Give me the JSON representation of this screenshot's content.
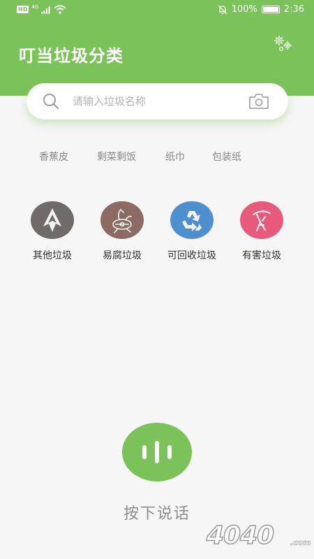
{
  "status_bar": {
    "hd": "HD",
    "network": "4G",
    "battery_text": "100%",
    "battery_level": 1.0,
    "time": "2:36"
  },
  "header": {
    "title": "叮当垃圾分类",
    "settings_icon": "gears-icon",
    "background_color": "#7cc25a"
  },
  "search": {
    "placeholder": "请输入垃圾名称",
    "value": "",
    "search_icon": "search-icon",
    "camera_icon": "camera-icon"
  },
  "hot_tags": [
    "香蕉皮",
    "剩菜剩饭",
    "纸巾",
    "包装纸"
  ],
  "categories": [
    {
      "label": "其他垃圾",
      "icon": "other-waste-icon",
      "color": "#6e6b69"
    },
    {
      "label": "易腐垃圾",
      "icon": "food-waste-icon",
      "color": "#8c6b64"
    },
    {
      "label": "可回收垃圾",
      "icon": "recycle-icon",
      "color": "#4e8fce"
    },
    {
      "label": "有害垃圾",
      "icon": "hazardous-waste-icon",
      "color": "#e85a7b"
    }
  ],
  "voice": {
    "label": "按下说话",
    "icon": "voice-wave-icon"
  },
  "watermark": {
    "text": "4040",
    "suffix": ".com"
  }
}
